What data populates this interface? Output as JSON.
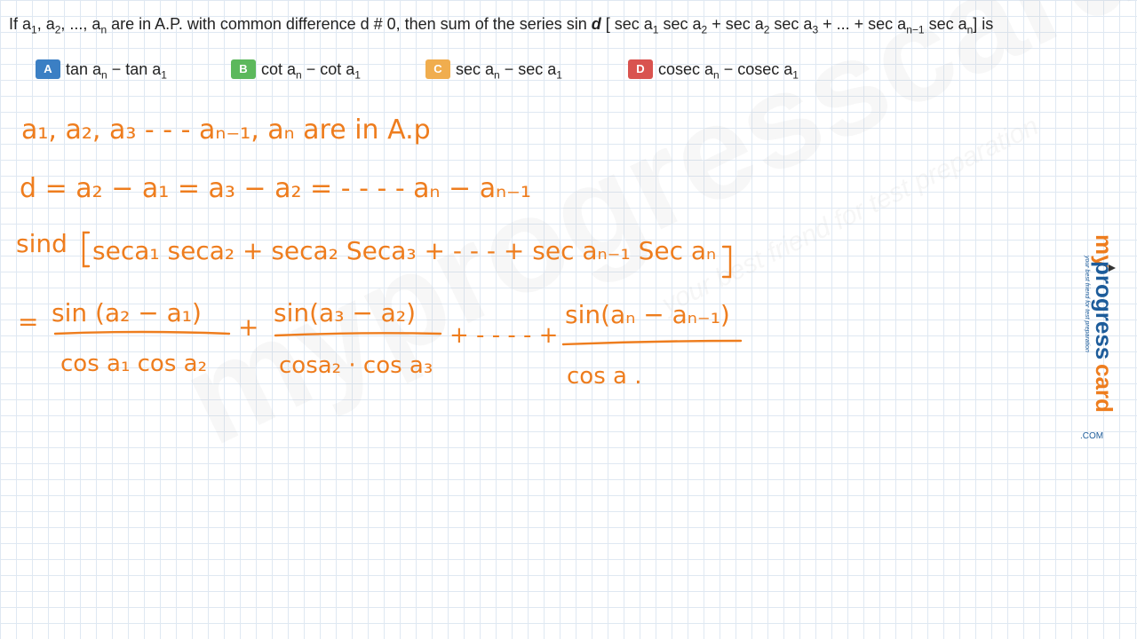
{
  "question": {
    "p1": "If a",
    "s1": "1",
    "p2": ", a",
    "s2": "2",
    "p3": ", ..., a",
    "s3": "n",
    "p4": " are in A.P. with common difference d # 0, then sum of the series sin ",
    "d": "d",
    "p5": " [ sec a",
    "s5": "1",
    "p6": " sec a",
    "s6": "2",
    "p7": " +  sec a",
    "s7": "2",
    "p8": " sec a",
    "s8": "3",
    "p9": " + ... + sec a",
    "s9": "n−1",
    "p10": " sec a",
    "s10": "n",
    "p11": "] is"
  },
  "options": [
    {
      "letter": "A",
      "color": "#3b7fc4",
      "t1": "tan a",
      "s1": "n",
      "t2": " − tan a",
      "s2": "1"
    },
    {
      "letter": "B",
      "color": "#5cb85c",
      "t1": "cot a",
      "s1": "n",
      "t2": " − cot a",
      "s2": "1"
    },
    {
      "letter": "C",
      "color": "#f0ad4e",
      "t1": "sec a",
      "s1": "n",
      "t2": " − sec a",
      "s2": "1"
    },
    {
      "letter": "D",
      "color": "#d9534f",
      "t1": "cosec a",
      "s1": "n",
      "t2": " − cosec a",
      "s2": "1"
    }
  ],
  "handwriting": {
    "line1": "a₁, a₂, a₃ - - - aₙ₋₁, aₙ  are  in  A.p",
    "line2": "d = a₂ − a₁  =  a₃ − a₂  =  - - - -  aₙ − aₙ₋₁",
    "line3_prefix": "sind",
    "line3_body": "seca₁ seca₂ + seca₂ Seca₃ + - - - + sec aₙ₋₁ Sec aₙ",
    "eq": "=",
    "f1_num": "sin (a₂ − a₁)",
    "f1_den": "cos a₁ cos a₂",
    "plus1": "+",
    "f2_num": "sin(a₃ − a₂)",
    "f2_den": "cosa₂ · cos a₃",
    "dots": "+ - - - - +",
    "f3_num": "sin(aₙ − aₙ₋₁)",
    "f3_den": "cos a ."
  },
  "watermark": {
    "text": "myprogresscard.com",
    "tagline": "your best friend for test preparation"
  },
  "logo": {
    "my": "my",
    "progress": "progress",
    "card": "card",
    "com": ".COM",
    "tagline": "your best friend for test preparation"
  }
}
